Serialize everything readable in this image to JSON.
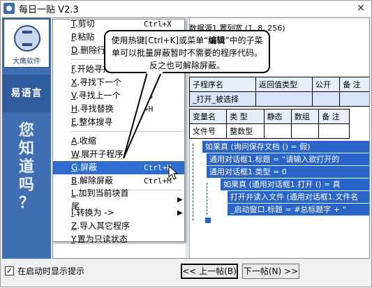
{
  "window": {
    "title": "每日一贴 V2.3",
    "close": "✕"
  },
  "left_panel": {
    "logo_text": "大鹰软件",
    "yiyu": "易语言",
    "vertical": [
      "您",
      "知",
      "道",
      "吗",
      "？"
    ]
  },
  "code": {
    "header": "数据源1.置列宽 (1, 8, 256)",
    "sub_table": {
      "headers": [
        "子程序名",
        "返回值类型",
        "公开",
        "备 注"
      ],
      "rows": [
        [
          "_打开_被选择",
          "",
          "",
          ""
        ]
      ]
    },
    "var_table": {
      "headers": [
        "变量名",
        "类 型",
        "静态",
        "数组",
        "备 注"
      ],
      "rows": [
        [
          "文件号",
          "整数型",
          "",
          "",
          ""
        ]
      ]
    },
    "lines": [
      "如果真 (询问保存文档 () = 假)",
      "通用对话框1.标题 = “请输入欲打开的",
      "通用对话框1.类型 = 0",
      "如果真 (通用对话框1.打开 () = 真",
      "打开并读入文件 (通用对话框1.文件名",
      "_启动窗口.标题 = #总标题字 + “"
    ]
  },
  "menu": {
    "items": [
      {
        "key": "T",
        "label": ".剪切",
        "shortcut": "Ctrl+X",
        "name": "menu-item-cut"
      },
      {
        "key": "P",
        "label": ".粘贴",
        "shortcut": "",
        "name": "menu-item-paste"
      },
      {
        "key": "D",
        "label": ".删除行",
        "shortcut": "",
        "name": "menu-item-delete-line"
      },
      {
        "key": "F",
        "label": ".开始寻找",
        "shortcut": "",
        "name": "menu-item-find"
      },
      {
        "key": "X",
        "label": ".寻找下一个",
        "shortcut": "",
        "name": "menu-item-find-next"
      },
      {
        "key": "V",
        "label": ".寻找上一个",
        "shortcut": "F3",
        "name": "menu-item-find-prev"
      },
      {
        "key": "H",
        "label": ".寻找替换",
        "shortcut": "+H",
        "name": "menu-item-replace"
      },
      {
        "key": "E",
        "label": ".整体搜寻",
        "shortcut": "",
        "name": "menu-item-global-search"
      },
      {
        "key": "A",
        "label": ".收缩",
        "shortcut": "",
        "name": "menu-item-collapse"
      },
      {
        "key": "W",
        "label": ".展开子程序",
        "shortcut": "",
        "name": "menu-item-expand"
      },
      {
        "key": "G",
        "label": ".屏蔽",
        "shortcut": "Ctrl+K",
        "name": "menu-item-block"
      },
      {
        "key": "B",
        "label": ".解除屏蔽",
        "shortcut": "Ctrl+M",
        "name": "menu-item-unblock"
      },
      {
        "key": "L",
        "label": ".加到当前块首尾",
        "shortcut": "",
        "name": "menu-item-wrap"
      },
      {
        "key": "I",
        "label": ".转换为 ->",
        "shortcut": "",
        "name": "menu-item-convert"
      },
      {
        "key": "Z",
        "label": ".导入其它程序",
        "shortcut": "",
        "name": "menu-item-import"
      },
      {
        "key": "Y",
        "label": ".置为只读状态",
        "shortcut": "",
        "name": "menu-item-readonly"
      }
    ]
  },
  "tooltip": {
    "pre": "使用热键[Ctrl+K]或菜单“",
    "bold": "编辑",
    "post": "”中的子菜单可以批量屏蔽暂时不需要的程序代码。反之也可解除屏蔽。"
  },
  "footer": {
    "checkbox_label": "在启动时显示提示",
    "checked": "✓",
    "prev_button": "<< 上一帖(B)",
    "next_button": "下一帖(N) >>"
  }
}
